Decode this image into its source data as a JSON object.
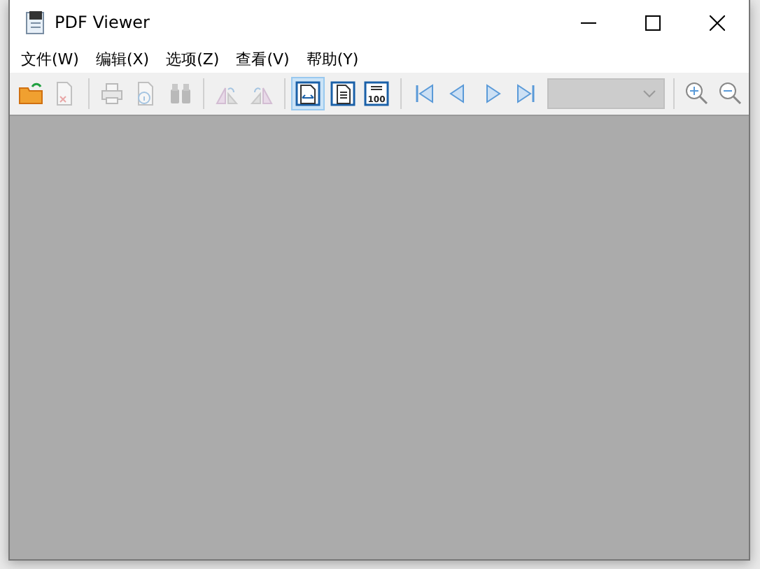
{
  "window": {
    "title": "PDF Viewer"
  },
  "menu": [
    {
      "label": "文件(W)"
    },
    {
      "label": "编辑(X)"
    },
    {
      "label": "选项(Z)"
    },
    {
      "label": "查看(V)"
    },
    {
      "label": "帮助(Y)"
    }
  ],
  "toolbar": [
    {
      "kind": "button",
      "disabled": false,
      "selected": false
    },
    {
      "kind": "button",
      "disabled": true,
      "selected": false
    },
    {
      "kind": "separator"
    },
    {
      "kind": "button",
      "disabled": true,
      "selected": false
    },
    {
      "kind": "button",
      "disabled": true,
      "selected": false
    },
    {
      "kind": "button",
      "disabled": true,
      "selected": false
    },
    {
      "kind": "separator"
    },
    {
      "kind": "button",
      "disabled": true,
      "selected": false
    },
    {
      "kind": "button",
      "disabled": true,
      "selected": false
    },
    {
      "kind": "separator"
    },
    {
      "kind": "button",
      "disabled": false,
      "selected": true
    },
    {
      "kind": "button",
      "disabled": false,
      "selected": false
    },
    {
      "kind": "button",
      "text": "100",
      "disabled": false,
      "selected": false
    },
    {
      "kind": "separator"
    },
    {
      "kind": "button",
      "disabled": false,
      "selected": false
    },
    {
      "kind": "button",
      "disabled": false,
      "selected": false
    },
    {
      "kind": "button",
      "disabled": false,
      "selected": false
    },
    {
      "kind": "button",
      "disabled": false,
      "selected": false
    },
    {
      "kind": "dropdown",
      "disabled": true
    },
    {
      "kind": "separator"
    },
    {
      "kind": "button",
      "disabled": false,
      "selected": false
    },
    {
      "kind": "button",
      "disabled": false,
      "selected": false
    }
  ]
}
